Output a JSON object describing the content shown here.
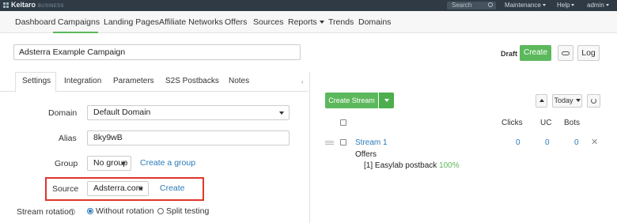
{
  "topbar": {
    "logo": "Keitaro",
    "edition": "BUSINESS",
    "search_placeholder": "Search",
    "maintenance": "Maintenance",
    "help": "Help",
    "admin": "admin"
  },
  "nav": {
    "items": [
      "Dashboard",
      "Campaigns",
      "Landing Pages",
      "Affiliate Networks",
      "Offers",
      "Sources",
      "Reports",
      "Trends",
      "Domains"
    ],
    "active": "Campaigns"
  },
  "campaign": {
    "name": "Adsterra Example Campaign",
    "status": "Draft",
    "create_label": "Create",
    "log_label": "Log"
  },
  "tabs": {
    "items": [
      "Settings",
      "Integration",
      "Parameters",
      "S2S Postbacks",
      "Notes"
    ],
    "active": "Settings"
  },
  "form": {
    "domain_label": "Domain",
    "domain_value": "Default Domain",
    "alias_label": "Alias",
    "alias_value": "8ky9wB",
    "group_label": "Group",
    "group_value": "No group",
    "group_link": "Create a group",
    "source_label": "Source",
    "source_value": "Adsterra.com",
    "source_link": "Create",
    "rotation_label": "Stream rotation",
    "rotation_options": [
      "Without rotation",
      "Split testing"
    ],
    "rotation_selected": "Without rotation"
  },
  "streams": {
    "create_label": "Create Stream",
    "period": "Today",
    "columns": [
      "Clicks",
      "UC",
      "Bots"
    ],
    "rows": [
      {
        "name": "Stream 1",
        "offers_label": "Offers",
        "offer_text": "[1] Easylab postback",
        "offer_share": "100%",
        "clicks": "0",
        "uc": "0",
        "bots": "0"
      }
    ]
  },
  "colors": {
    "accent_green": "#5cb85c",
    "link_blue": "#2a7ab8",
    "highlight_red": "#e0362c",
    "topbar": "#2f3a44"
  }
}
